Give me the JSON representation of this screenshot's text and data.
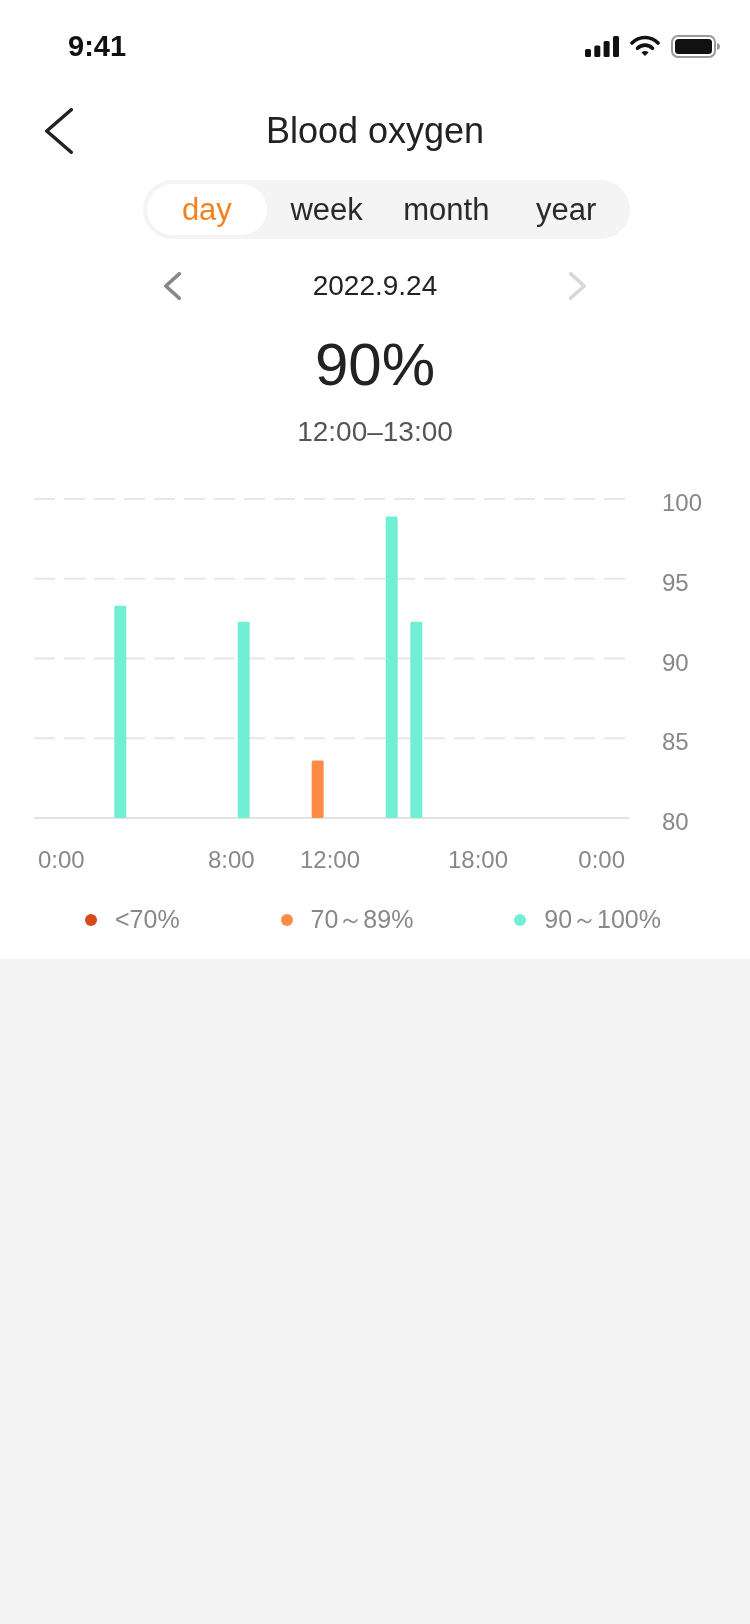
{
  "status_bar": {
    "time": "9:41"
  },
  "header": {
    "title": "Blood oxygen"
  },
  "tabs": [
    {
      "label": "day",
      "selected": true
    },
    {
      "label": "week",
      "selected": false
    },
    {
      "label": "month",
      "selected": false
    },
    {
      "label": "year",
      "selected": false
    }
  ],
  "date_nav": {
    "date": "2022.9.24",
    "previous": {
      "disabled": false
    },
    "next": {
      "disabled": true
    }
  },
  "summary": {
    "value": "90%",
    "range": "12:00–13:00"
  },
  "chart": {
    "chart_data": {
      "type": "bar",
      "x": [
        3.5,
        8.5,
        11.5,
        14.5,
        15.5
      ],
      "xlim": [
        0,
        24
      ],
      "xticks": [
        {
          "value": 0,
          "label": "0:00"
        },
        {
          "value": 8,
          "label": "8:00"
        },
        {
          "value": 12,
          "label": "12:00"
        },
        {
          "value": 18,
          "label": "18:00"
        },
        {
          "value": 24,
          "label": "0:00"
        }
      ],
      "ylim": [
        80,
        100
      ],
      "yticks": [
        80,
        85,
        90,
        95,
        100
      ],
      "grid": true,
      "stacked": true,
      "legend": true,
      "series": [
        {
          "name": "<70%",
          "color": "#d5491f",
          "values": [
            null,
            null,
            null,
            null,
            null
          ]
        },
        {
          "name": "70～89%",
          "color": "#ff8c44",
          "values": [
            null,
            null,
            83.6,
            null,
            null
          ]
        },
        {
          "name": "90～100%",
          "color": "#70efd4",
          "values": [
            93.3,
            92.3,
            null,
            98.9,
            92.3
          ]
        }
      ]
    }
  }
}
